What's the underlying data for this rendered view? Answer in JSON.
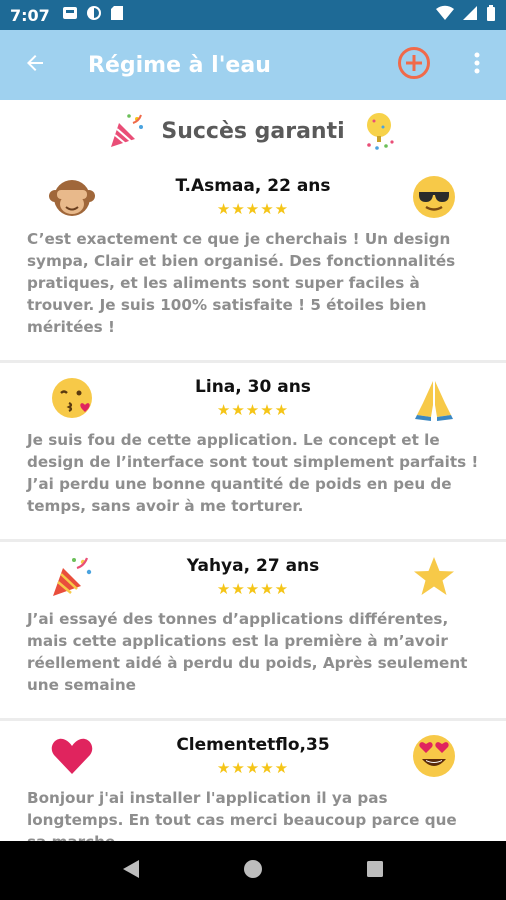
{
  "status_bar": {
    "time": "7:07",
    "left_icons": [
      "inbox-icon",
      "circle-app-icon",
      "sd-card-icon"
    ],
    "right_icons": [
      "wifi-icon",
      "signal-icon",
      "battery-icon"
    ]
  },
  "app_bar": {
    "title": "Régime à l'eau",
    "back_icon": "arrow-left-icon",
    "add_icon": "add-circle-icon",
    "menu_icon": "more-vert-icon",
    "accent_color": "#f06a4a",
    "background_color": "#9fd1ef"
  },
  "headline": {
    "text": "Succès garanti",
    "left_emoji": "party-popper-icon",
    "right_emoji": "confetti-icon"
  },
  "reviews": [
    {
      "name": "T.Asmaa, 22 ans",
      "stars": "★★★★★",
      "left_emoji": "see-no-evil-monkey-icon",
      "right_emoji": "sunglasses-face-icon",
      "text": "C’est exactement ce que je cherchais ! Un design sympa, Clair et bien organisé. Des fonctionnalités pratiques, et les aliments sont super faciles à trouver. Je suis 100% satisfaite ! 5 étoiles bien méritées !"
    },
    {
      "name": "Lina, 30 ans",
      "stars": "★★★★★",
      "left_emoji": "kissing-heart-face-icon",
      "right_emoji": "folded-hands-icon",
      "text": "Je suis fou de cette application. Le concept et le design de l’interface sont tout simplement parfaits ! J’ai perdu une bonne quantité de poids en peu de temps, sans avoir à me torturer."
    },
    {
      "name": "Yahya, 27 ans",
      "stars": "★★★★★",
      "left_emoji": "party-popper-icon",
      "right_emoji": "star-icon",
      "text": "J’ai essayé des tonnes d’applications différentes, mais cette applications est la première à m’avoir réellement aidé à perdu du poids, Après seulement une semaine"
    },
    {
      "name": "Clementetflo,35",
      "stars": "★★★★★",
      "left_emoji": "red-heart-icon",
      "right_emoji": "heart-eyes-face-icon",
      "text": "Bonjour j'ai installer l'application il ya pas longtemps. En tout cas merci beaucoup parce que sa marche"
    }
  ],
  "nav_bar": {
    "back_icon": "triangle-back-icon",
    "home_icon": "circle-home-icon",
    "recents_icon": "square-recents-icon"
  }
}
